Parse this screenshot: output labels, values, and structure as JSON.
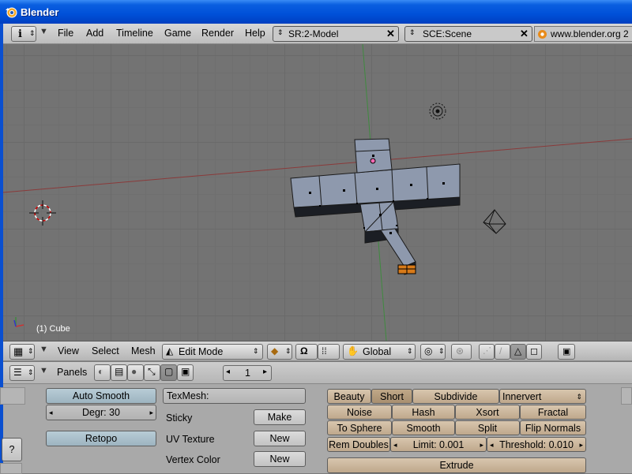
{
  "window": {
    "title": "Blender"
  },
  "menubar": {
    "menus": [
      "File",
      "Add",
      "Timeline",
      "Game",
      "Render",
      "Help"
    ],
    "screen_field": "SR:2-Model",
    "scene_field": "SCE:Scene",
    "url": "www.blender.org 2"
  },
  "viewport": {
    "object_label": "(1) Cube"
  },
  "viewport_header": {
    "menus": [
      "View",
      "Select",
      "Mesh"
    ],
    "mode": "Edit Mode",
    "orientation": "Global"
  },
  "buttons_header": {
    "panels_label": "Panels",
    "page": "1"
  },
  "mesh_panel": {
    "auto_smooth": "Auto Smooth",
    "degr": "Degr: 30",
    "retopo": "Retopo"
  },
  "texmesh_panel": {
    "texmesh": "TexMesh:",
    "sticky": "Sticky",
    "make": "Make",
    "uv_texture": "UV Texture",
    "uv_new": "New",
    "vertex_color": "Vertex Color",
    "vc_new": "New"
  },
  "mesh_tools": {
    "beauty": "Beauty",
    "short": "Short",
    "subdivide": "Subdivide",
    "innervert": "Innervert",
    "noise": "Noise",
    "hash": "Hash",
    "xsort": "Xsort",
    "fractal": "Fractal",
    "to_sphere": "To Sphere",
    "smooth": "Smooth",
    "split": "Split",
    "flip_normals": "Flip Normals",
    "rem_doubles": "Rem Doubles",
    "limit": "Limit: 0.001",
    "threshold": "Threshold: 0.010",
    "extrude": "Extrude"
  },
  "left_edge": {
    "help": "?"
  },
  "colors": {
    "title_blue": "#0050d8",
    "viewport_bg": "#737373",
    "x_axis": "#8a3a3a",
    "y_axis": "#3f8a3f",
    "mesh_face": "#8e99ad",
    "selected_vertex": "#ff8a00"
  }
}
